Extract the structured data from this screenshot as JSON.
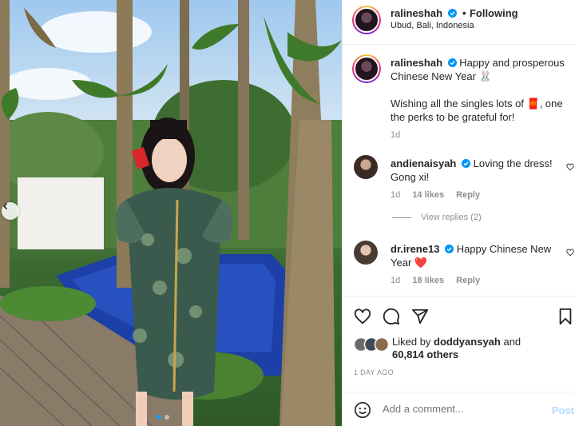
{
  "post_header": {
    "username": "ralineshah",
    "separator": "•",
    "follow_status": "Following",
    "location": "Ubud, Bali, Indonesia"
  },
  "caption": {
    "username": "ralineshah",
    "line1": "Happy and prosperous Chinese New Year 🐰",
    "line2": "Wishing all the singles lots of 🧧, one the perks to be grateful for!",
    "age": "1d"
  },
  "comments": [
    {
      "username": "andienaisyah",
      "text": "Loving the dress! Gong xi!",
      "age": "1d",
      "likes": "14 likes",
      "reply": "Reply"
    },
    {
      "username": "dr.irene13",
      "text": "Happy Chinese New Year ❤️",
      "age": "1d",
      "likes": "18 likes",
      "reply": "Reply"
    }
  ],
  "view_replies": "View replies (2)",
  "likes": {
    "prefix": "Liked by",
    "user": "doddyansyah",
    "joiner": "and",
    "others": "60,814 others"
  },
  "timestamp": "1 DAY AGO",
  "add_comment": {
    "placeholder": "Add a comment...",
    "post_label": "Post"
  },
  "icons": {
    "like": "heart-icon",
    "comment": "comment-icon",
    "share": "share-icon",
    "save": "bookmark-icon",
    "emoji": "emoji-icon",
    "verified": "verified-badge-icon",
    "prev": "chevron-left-icon"
  },
  "colors": {
    "verified": "#0095f6",
    "link_muted": "#8e8e8e",
    "post_disabled": "#b3dbff",
    "heart_red": "#ed4956"
  }
}
